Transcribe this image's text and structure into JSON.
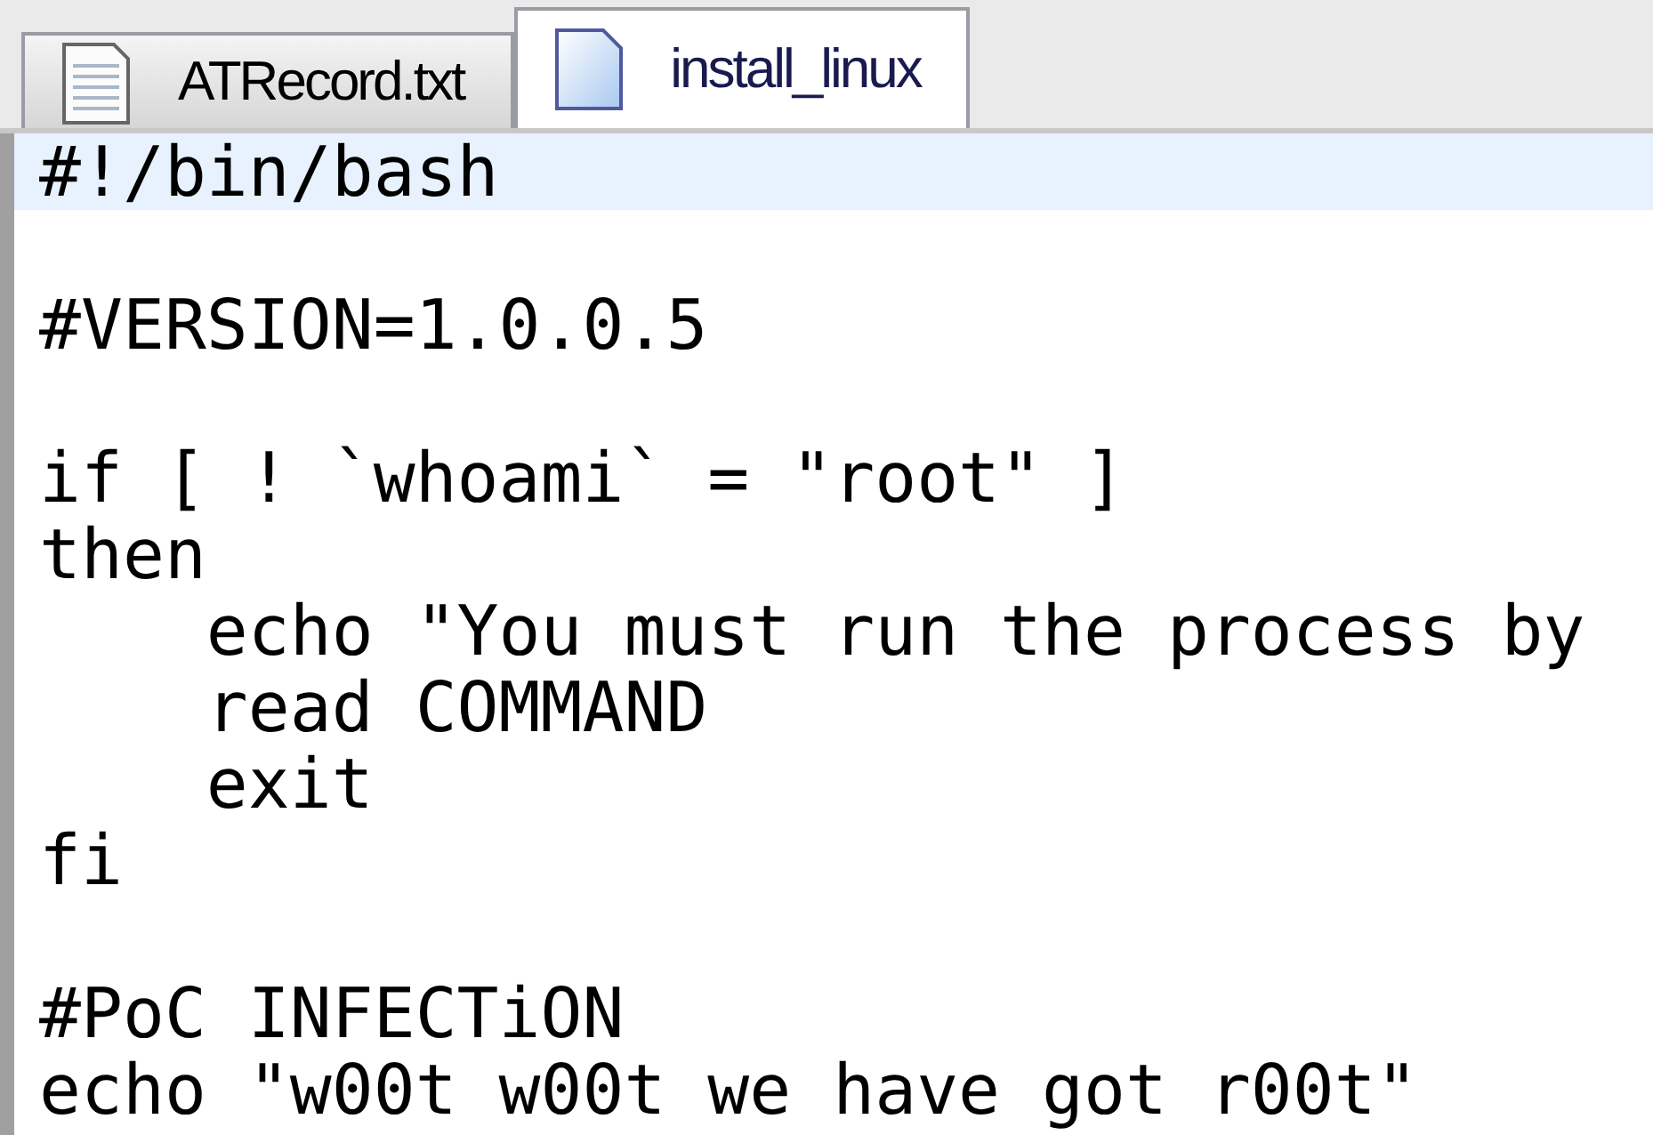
{
  "tabs": [
    {
      "label": "ATRecord.txt",
      "selected": false
    },
    {
      "label": "install_linux",
      "selected": true
    }
  ],
  "editor": {
    "lines": [
      {
        "kind": "code",
        "text": "#!/bin/bash",
        "current": true
      },
      {
        "kind": "blank"
      },
      {
        "kind": "code",
        "text": "#VERSION=1.0.0.5",
        "current": false
      },
      {
        "kind": "blank"
      },
      {
        "kind": "code",
        "text": "if [ ! `whoami` = \"root\" ]",
        "current": false
      },
      {
        "kind": "code",
        "text": "then",
        "current": false
      },
      {
        "kind": "code",
        "text": "    echo \"You must run the process by",
        "current": false
      },
      {
        "kind": "code",
        "text": "    read COMMAND",
        "current": false
      },
      {
        "kind": "code",
        "text": "    exit",
        "current": false
      },
      {
        "kind": "code",
        "text": "fi",
        "current": false
      },
      {
        "kind": "blank"
      },
      {
        "kind": "code",
        "text": "#PoC INFECTiON",
        "current": false
      },
      {
        "kind": "code",
        "text": "echo \"w00t w00t we have got r00t\"",
        "current": false
      }
    ]
  }
}
